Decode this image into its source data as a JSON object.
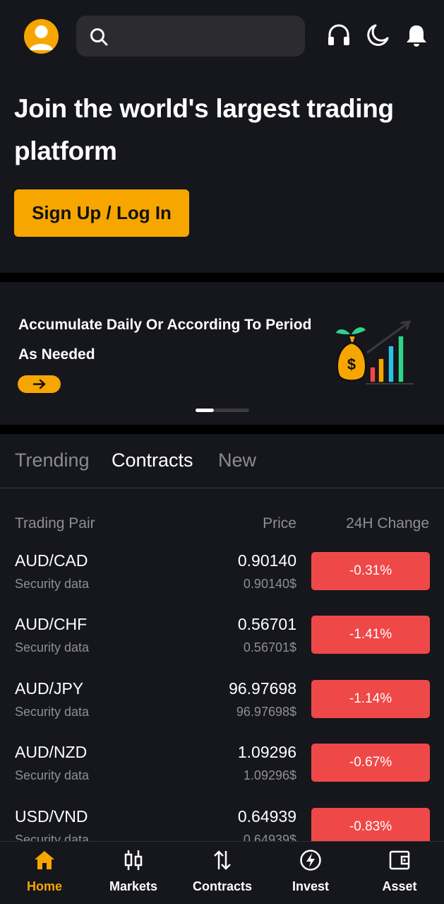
{
  "colors": {
    "accent": "#f7a600",
    "background": "#16161d",
    "negative": "#ef4848",
    "muted_text": "#8e8e94"
  },
  "header": {
    "avatar_icon": "user-avatar-icon",
    "search": {
      "placeholder": "",
      "value": "",
      "icon": "search-icon"
    },
    "icons": [
      "headset-icon",
      "moon-icon",
      "bell-icon"
    ]
  },
  "hero": {
    "title": "Join the world's largest trading platform",
    "cta_label": "Sign Up / Log In"
  },
  "banner": {
    "text": "Accumulate Daily Or According To Period As Needed",
    "arrow_icon": "arrow-right-icon",
    "illustration_icon": "money-bag-growth-chart-icon",
    "slide_active": 1,
    "slide_count": 2
  },
  "tabs": [
    {
      "label": "Trending",
      "active": false
    },
    {
      "label": "Contracts",
      "active": true
    },
    {
      "label": "New",
      "active": false
    }
  ],
  "table": {
    "headers": {
      "pair": "Trading Pair",
      "price": "Price",
      "change": "24H Change"
    },
    "rows": [
      {
        "pair": "AUD/CAD",
        "sub": "Security data",
        "price": "0.90140",
        "price_sub": "0.90140$",
        "change": "-0.31%"
      },
      {
        "pair": "AUD/CHF",
        "sub": "Security data",
        "price": "0.56701",
        "price_sub": "0.56701$",
        "change": "-1.41%"
      },
      {
        "pair": "AUD/JPY",
        "sub": "Security data",
        "price": "96.97698",
        "price_sub": "96.97698$",
        "change": "-1.14%"
      },
      {
        "pair": "AUD/NZD",
        "sub": "Security data",
        "price": "1.09296",
        "price_sub": "1.09296$",
        "change": "-0.67%"
      },
      {
        "pair": "USD/VND",
        "sub": "Security data",
        "price": "0.64939",
        "price_sub": "0.64939$",
        "change": "-0.83%"
      }
    ]
  },
  "bottom_nav": [
    {
      "label": "Home",
      "icon": "home-icon",
      "active": true
    },
    {
      "label": "Markets",
      "icon": "candlestick-icon",
      "active": false
    },
    {
      "label": "Contracts",
      "icon": "up-down-arrows-icon",
      "active": false
    },
    {
      "label": "Invest",
      "icon": "lightning-circle-icon",
      "active": false
    },
    {
      "label": "Asset",
      "icon": "wallet-icon",
      "active": false
    }
  ]
}
